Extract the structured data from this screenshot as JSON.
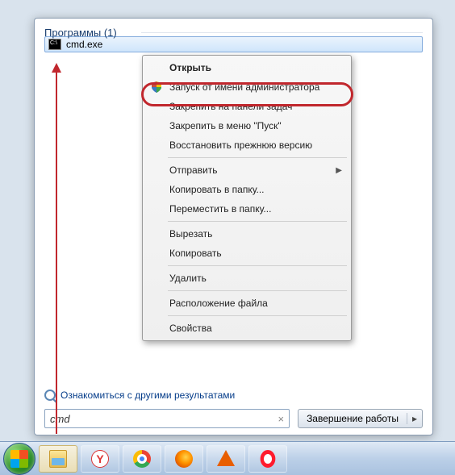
{
  "section_header": "Программы (1)",
  "program": {
    "name": "cmd.exe"
  },
  "context_menu": {
    "open": "Открыть",
    "run_as_admin": "Запуск от имени администратора",
    "pin_taskbar": "Закрепить на панели задач",
    "pin_start": "Закрепить в меню \"Пуск\"",
    "restore": "Восстановить прежнюю версию",
    "send_to": "Отправить",
    "copy_to": "Копировать в папку...",
    "move_to": "Переместить в папку...",
    "cut": "Вырезать",
    "copy": "Копировать",
    "delete": "Удалить",
    "file_location": "Расположение файла",
    "properties": "Свойства"
  },
  "more_results": "Ознакомиться с другими результатами",
  "search": {
    "value": "cmd",
    "clear": "×"
  },
  "shutdown": {
    "label": "Завершение работы",
    "arrow": "▸"
  },
  "taskbar": {
    "yandex_letter": "Y"
  }
}
